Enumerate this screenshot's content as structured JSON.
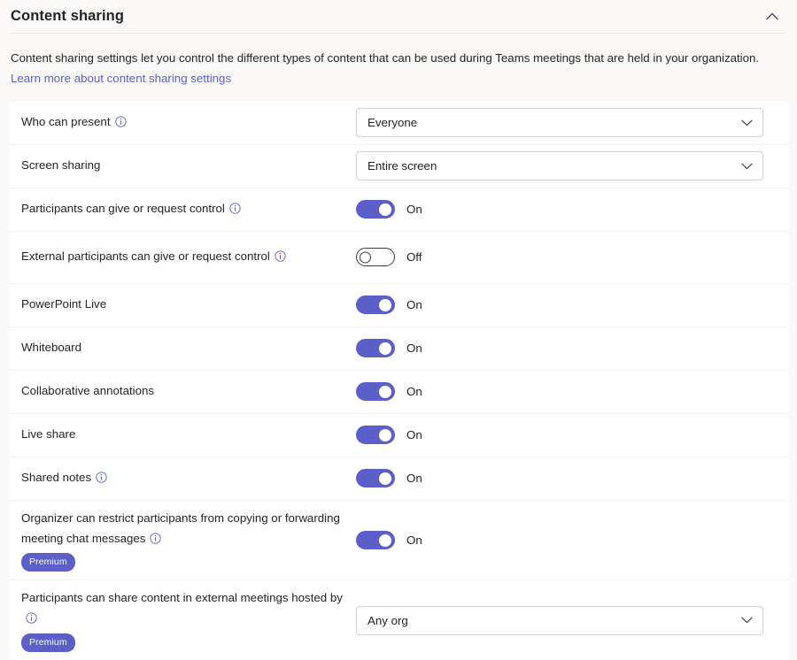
{
  "section": {
    "title": "Content sharing",
    "collapse_icon": "chevron-up-icon",
    "collapsed": false
  },
  "description": {
    "text": "Content sharing settings let you control the different types of content that can be used during Teams meetings that are held in your organization.",
    "link_text": "Learn more about content sharing settings"
  },
  "colors": {
    "accent": "#5b5fc7",
    "link": "#5b5fc7",
    "page_background": "#faf9f8",
    "card_background": "#ffffff",
    "divider": "#f3f2f1",
    "text": "#242424",
    "badge_background": "#5b5fc7",
    "badge_text": "#ffffff"
  },
  "labels": {
    "on": "On",
    "off": "Off",
    "premium": "Premium",
    "info_icon": "info-icon",
    "chevron_down_icon": "chevron-down-icon"
  },
  "settings": [
    {
      "id": "who-can-present",
      "label": "Who can present",
      "has_info": true,
      "premium": false,
      "control": "dropdown",
      "value": "Everyone"
    },
    {
      "id": "screen-sharing",
      "label": "Screen sharing",
      "has_info": false,
      "premium": false,
      "control": "dropdown",
      "value": "Entire screen"
    },
    {
      "id": "participants-can-give-or-request-control",
      "label": "Participants can give or request control",
      "has_info": true,
      "premium": false,
      "control": "toggle",
      "value": "On"
    },
    {
      "id": "external-participants-can-give-or-request-control",
      "label": "External participants can give or request control",
      "has_info": true,
      "premium": false,
      "control": "toggle",
      "value": "Off"
    },
    {
      "id": "powerpoint-live",
      "label": "PowerPoint Live",
      "has_info": false,
      "premium": false,
      "control": "toggle",
      "value": "On"
    },
    {
      "id": "whiteboard",
      "label": "Whiteboard",
      "has_info": false,
      "premium": false,
      "control": "toggle",
      "value": "On"
    },
    {
      "id": "collaborative-annotations",
      "label": "Collaborative annotations",
      "has_info": false,
      "premium": false,
      "control": "toggle",
      "value": "On"
    },
    {
      "id": "live-share",
      "label": "Live share",
      "has_info": false,
      "premium": false,
      "control": "toggle",
      "value": "On"
    },
    {
      "id": "shared-notes",
      "label": "Shared notes",
      "has_info": true,
      "premium": false,
      "control": "toggle",
      "value": "On"
    },
    {
      "id": "organizer-can-restrict-copying-forwarding",
      "label": "Organizer can restrict participants from copying or forwarding meeting chat messages",
      "has_info": true,
      "premium": true,
      "control": "toggle",
      "value": "On"
    },
    {
      "id": "participants-can-share-content-in-external-meetings",
      "label": "Participants can share content in external meetings hosted by",
      "has_info": true,
      "premium": true,
      "control": "dropdown",
      "value": "Any org"
    }
  ]
}
